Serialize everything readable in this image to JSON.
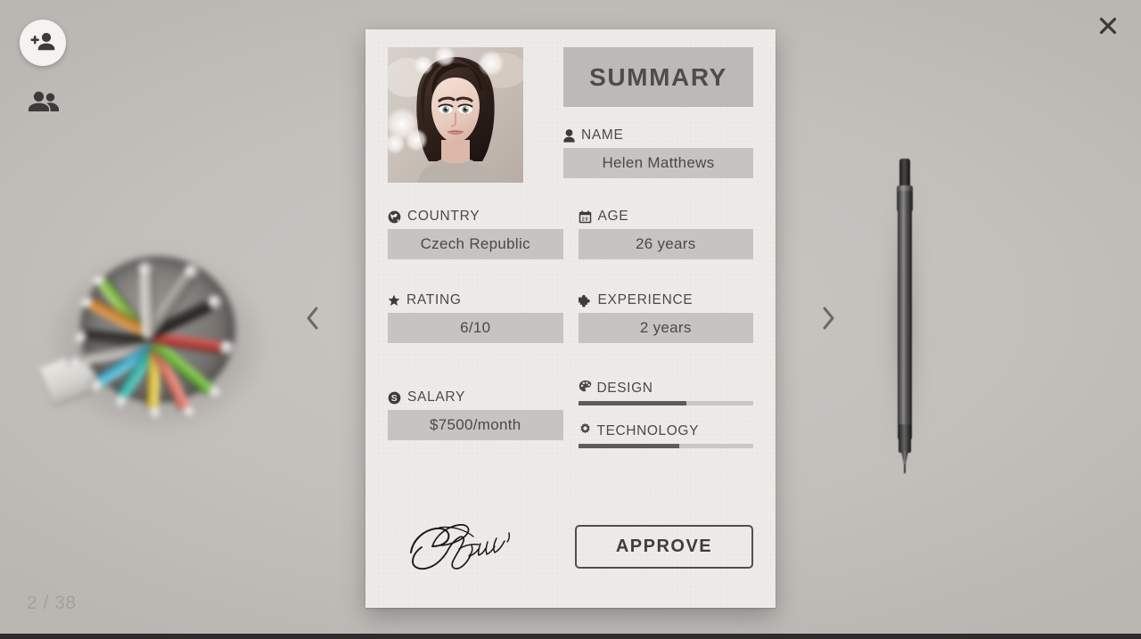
{
  "background": {
    "color": "#c3c0bc",
    "objects": {
      "pen_cup_name": "pen-cup-photo",
      "pencil_name": "mechanical-pencil-photo"
    }
  },
  "controls": {
    "add_person_icon": "person-add-icon",
    "people_icon": "people-group-icon",
    "close_icon": "close-icon",
    "prev_icon": "chevron-left-icon",
    "next_icon": "chevron-right-icon"
  },
  "counter": {
    "current": "2",
    "separator": "/",
    "total": "38",
    "text": "2 / 38"
  },
  "card": {
    "banner": {
      "title": "SUMMARY"
    },
    "portrait": {
      "alt": "portrait-photo-of-woman"
    },
    "name": {
      "label": "NAME",
      "icon": "person-icon",
      "value": "Helen Matthews"
    },
    "fields": [
      {
        "label": "COUNTRY",
        "icon": "globe-icon",
        "value": "Czech Republic"
      },
      {
        "label": "AGE",
        "icon": "calendar-icon",
        "value": "26 years"
      },
      {
        "label": "RATING",
        "icon": "star-icon",
        "value": "6/10"
      },
      {
        "label": "EXPERIENCE",
        "icon": "puzzle-icon",
        "value": "2 years"
      }
    ],
    "salary": {
      "label": "SALARY",
      "icon": "dollar-coin-icon",
      "value": "$7500/month"
    },
    "skills": [
      {
        "label": "DESIGN",
        "icon": "palette-icon",
        "percent": 62
      },
      {
        "label": "TECHNOLOGY",
        "icon": "gear-icon",
        "percent": 58
      }
    ],
    "signature": {
      "name": "handwritten-signature"
    },
    "approve": {
      "label": "APPROVE"
    },
    "colors": {
      "paper": "#eceae6",
      "banner": "#bcbab7",
      "field_box": "#c6c4c0",
      "ink": "#4b4a48",
      "skill_fill": "#5d5c5a",
      "skill_track": "#c9c7c3"
    }
  }
}
